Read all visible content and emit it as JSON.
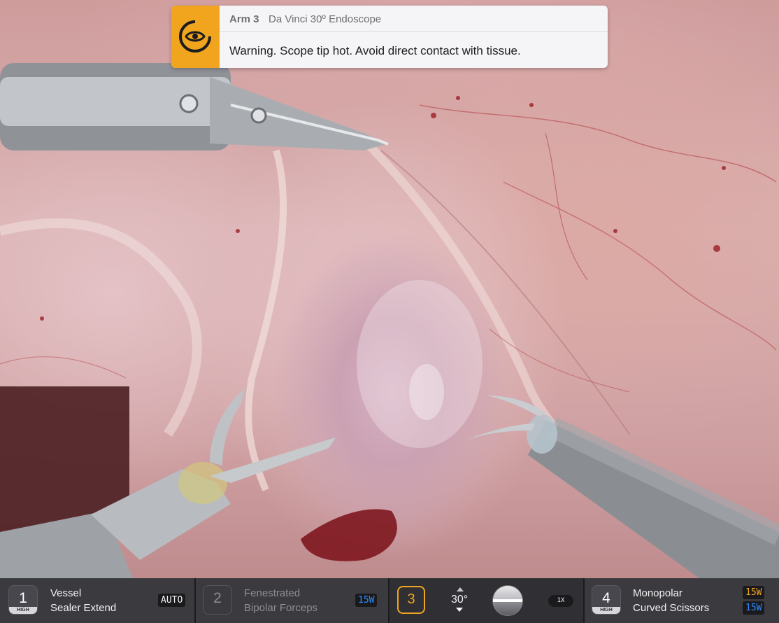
{
  "notification": {
    "arm_label": "Arm 3",
    "device": "Da Vinci 30º Endoscope",
    "message": "Warning. Scope tip hot. Avoid direct contact with tissue.",
    "icon": "eye-icon",
    "accent_color": "#f1a51f"
  },
  "instruments": [
    {
      "number": "1",
      "level": "HIGH",
      "name_line1": "Vessel",
      "name_line2": "Sealer Extend",
      "energy": "AUTO",
      "active": true
    },
    {
      "number": "2",
      "level": "",
      "name_line1": "Fenestrated",
      "name_line2": "Bipolar Forceps",
      "energy": "15W",
      "active": false
    },
    {
      "number": "4",
      "level": "HIGH",
      "name_line1": "Monopolar",
      "name_line2": "Curved Scissors",
      "energy_cut": "15W",
      "energy_coag": "15W",
      "active": true
    }
  ],
  "camera": {
    "number": "3",
    "angle": "30°",
    "zoom": "1X",
    "icons": [
      "angle-up-icon",
      "angle-down-icon",
      "horizon-indicator-icon"
    ]
  },
  "colors": {
    "energy_blue": "#2d8cff",
    "energy_orange": "#f1a51f",
    "bar_background": "#2b2b2f"
  }
}
